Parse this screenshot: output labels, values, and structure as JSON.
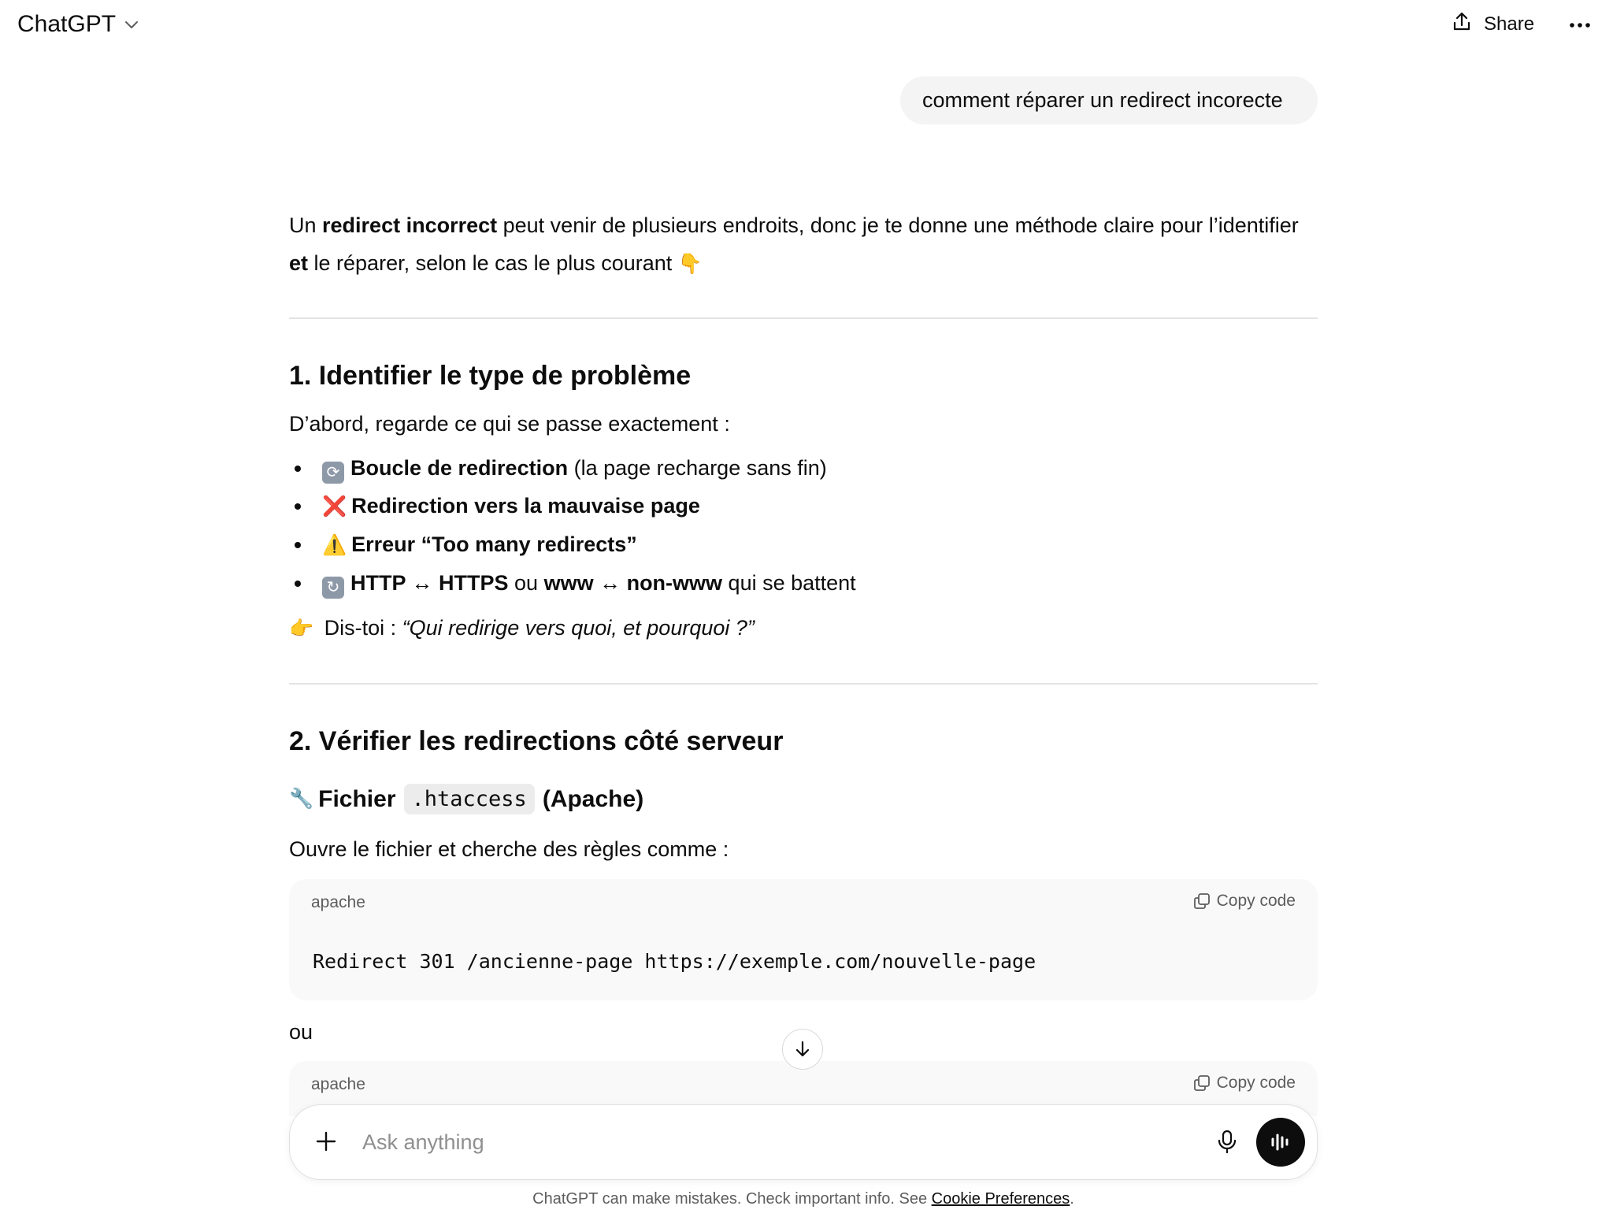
{
  "header": {
    "app_name": "ChatGPT",
    "model_menu_icon": "chevron-down-icon",
    "share_label": "Share",
    "share_icon": "share-upload-icon",
    "more_icon": "more-horizontal-icon"
  },
  "conversation": {
    "user_message": "comment réparer un redirect incorecte",
    "intro": {
      "t1": "Un ",
      "b1": "redirect incorrect",
      "t2": " peut venir de plusieurs endroits, donc je te donne une méthode claire pour l’identifier ",
      "b2": "et",
      "t3": " le réparer, selon le cas le plus courant ",
      "emoji": "👇"
    },
    "section1": {
      "title": "1. Identifier le type de problème",
      "lead": "D’abord, regarde ce qui se passe exactement :",
      "bullets": [
        {
          "emoji": "🔁",
          "bold": "Boucle de redirection",
          "text": " (la page recharge sans fin)"
        },
        {
          "emoji": "❌",
          "bold": "Redirection vers la mauvaise page",
          "text": ""
        },
        {
          "emoji": "⚠️",
          "bold": "Erreur “Too many redirects”",
          "text": ""
        },
        {
          "emoji": "🔄",
          "b1": "HTTP ↔ HTTPS",
          "t1": " ou ",
          "b2": "www ↔ non-www",
          "t2": " qui se battent"
        }
      ],
      "tip_emoji": "👉",
      "tip_prefix": " Dis-toi : ",
      "tip_quote": "“Qui redirige vers quoi, et pourquoi ?”"
    },
    "section2": {
      "title": "2. Vérifier les redirections côté serveur",
      "sub_emoji": "🔧",
      "sub_prefix": "Fichier",
      "sub_code": ".htaccess",
      "sub_suffix": "(Apache)",
      "lead": "Ouvre le fichier et cherche des règles comme :",
      "code_blocks": [
        {
          "language": "apache",
          "copy_label": "Copy code",
          "code": "Redirect 301 /ancienne-page https://exemple.com/nouvelle-page"
        },
        {
          "language": "apache",
          "copy_label": "Copy code",
          "code": ""
        }
      ],
      "or_text": "ou"
    }
  },
  "composer": {
    "placeholder": "Ask anything",
    "value": "",
    "plus_icon": "plus-icon",
    "mic_icon": "microphone-icon",
    "voice_icon": "voice-mode-icon"
  },
  "footer": {
    "text": "ChatGPT can make mistakes. Check important info. See ",
    "link": "Cookie Preferences",
    "suffix": "."
  },
  "colors": {
    "text": "#0d0d0d",
    "muted": "#5d5d5d",
    "bubble": "#f4f4f4",
    "code_bg": "#f9f9f9",
    "divider": "#e3e3e3",
    "voice_button": "#0d0d0d"
  }
}
